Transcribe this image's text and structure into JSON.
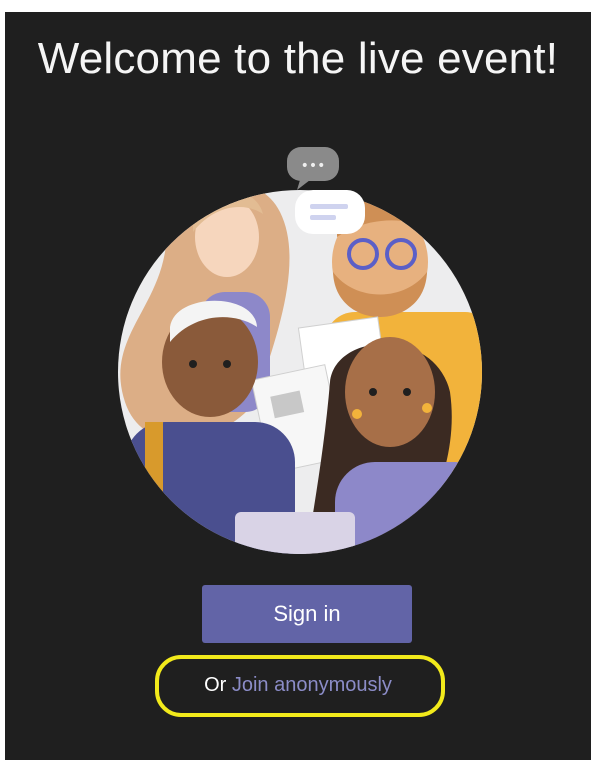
{
  "welcome": {
    "title": "Welcome to the live event!"
  },
  "illustration": {
    "bubble_text": "•••"
  },
  "signin": {
    "label": "Sign in"
  },
  "join": {
    "prefix": "Or",
    "link": "Join anonymously"
  },
  "colors": {
    "background": "#1f1f1f",
    "accent": "#6264a7",
    "link": "#8b8cc7",
    "highlight": "#f2ea1b"
  }
}
